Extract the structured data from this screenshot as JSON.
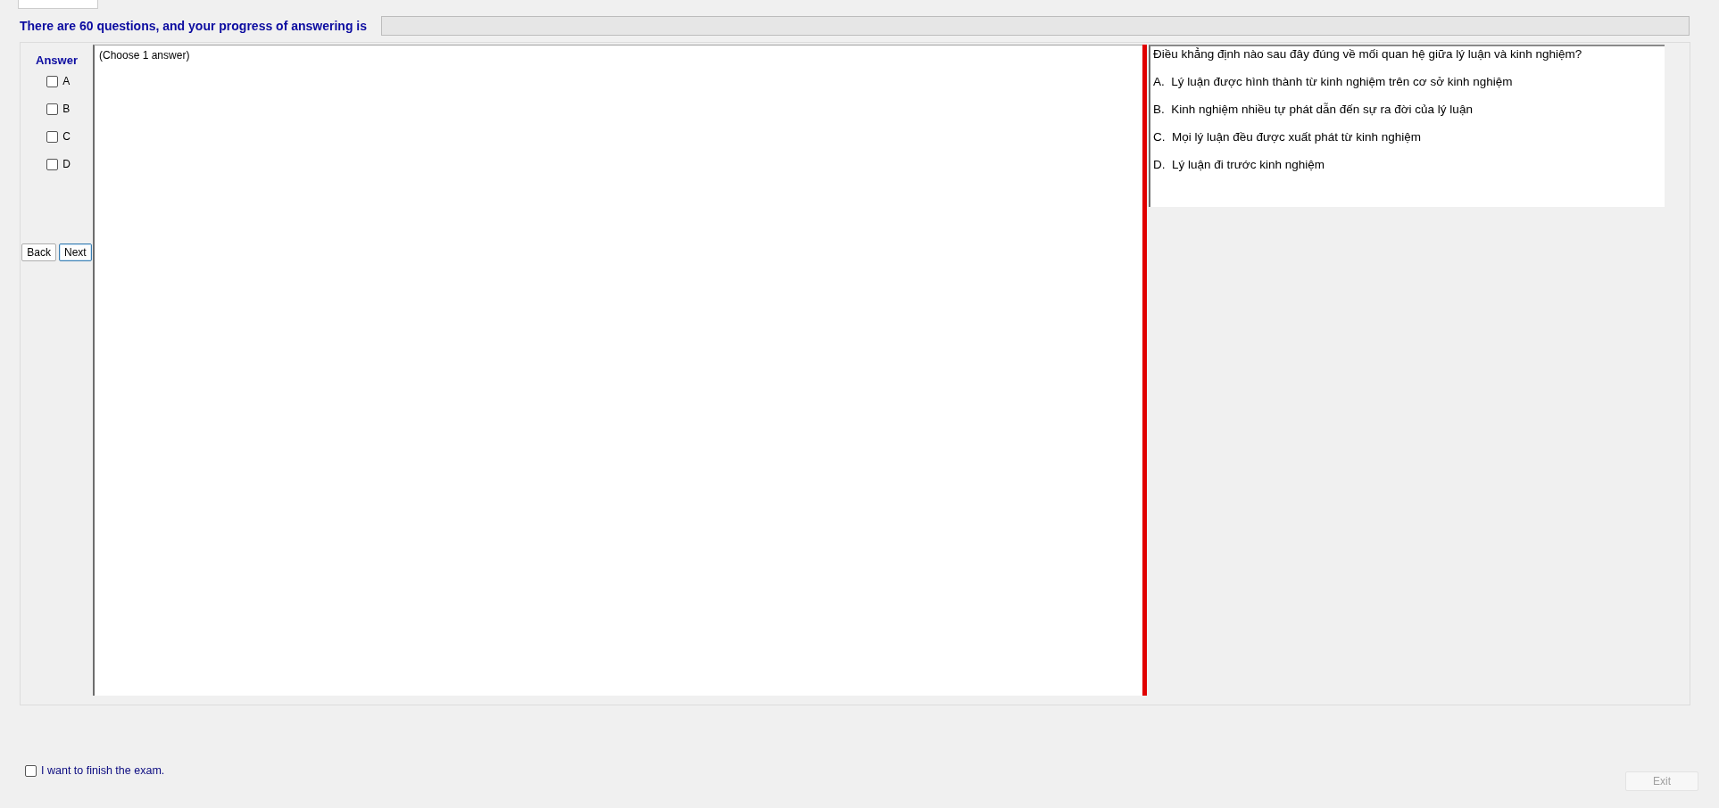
{
  "header": {
    "text": "There are 60 questions, and your progress of answering is",
    "progress": {
      "level": 0
    }
  },
  "answer_panel": {
    "title": "Answer",
    "options": [
      {
        "label": "A",
        "checked": false
      },
      {
        "label": "B",
        "checked": false
      },
      {
        "label": "C",
        "checked": false
      },
      {
        "label": "D",
        "checked": false
      }
    ],
    "buttons": [
      {
        "label": "Back",
        "focused": false
      },
      {
        "label": "Next",
        "focused": true
      }
    ]
  },
  "instruction": "(Choose 1 answer)",
  "question": {
    "text": "Điều khẳng định nào sau đây đúng về mối quan hệ giữa lý luận và kinh nghiệm?",
    "choices": [
      "A.  Lý luận được hình thành từ kinh nghiệm trên cơ sở kinh nghiệm",
      "B.  Kinh nghiệm nhiều tự phát dẫn đến sự ra đời của lý luận",
      "C.  Mọi lý luận đều được xuất phát từ kinh nghiệm",
      "D.  Lý luận đi trước kinh nghiệm"
    ]
  },
  "finish": {
    "label": "I want to finish the exam.",
    "checked": false
  },
  "exit_button": {
    "label": "Exit",
    "disabled": true
  }
}
